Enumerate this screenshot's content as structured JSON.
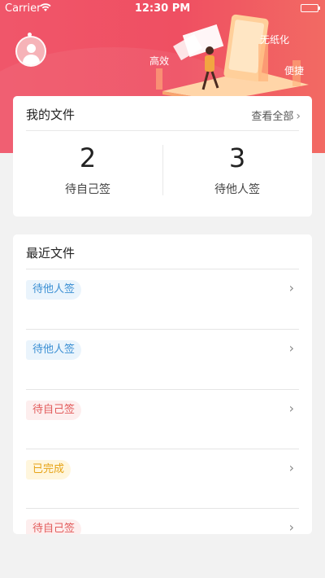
{
  "status_bar": {
    "carrier": "Carrier",
    "time": "12:30 PM"
  },
  "banner": {
    "tags": [
      "高效",
      "无纸化",
      "便捷"
    ]
  },
  "my_files": {
    "title": "我的文件",
    "view_all": "查看全部",
    "stats": [
      {
        "count": "2",
        "label": "待自己签"
      },
      {
        "count": "3",
        "label": "待他人签"
      }
    ]
  },
  "recent_files": {
    "title": "最近文件",
    "rows": [
      {
        "status": "待他人签",
        "tone": "blue"
      },
      {
        "status": "待他人签",
        "tone": "blue"
      },
      {
        "status": "待自己签",
        "tone": "red"
      },
      {
        "status": "已完成",
        "tone": "amber"
      },
      {
        "status": "待自己签",
        "tone": "red"
      }
    ]
  },
  "colors": {
    "header": "#ef4f62",
    "badge_blue": "#3b8fd3",
    "badge_red": "#e25b5b",
    "badge_amber": "#e6a317"
  }
}
